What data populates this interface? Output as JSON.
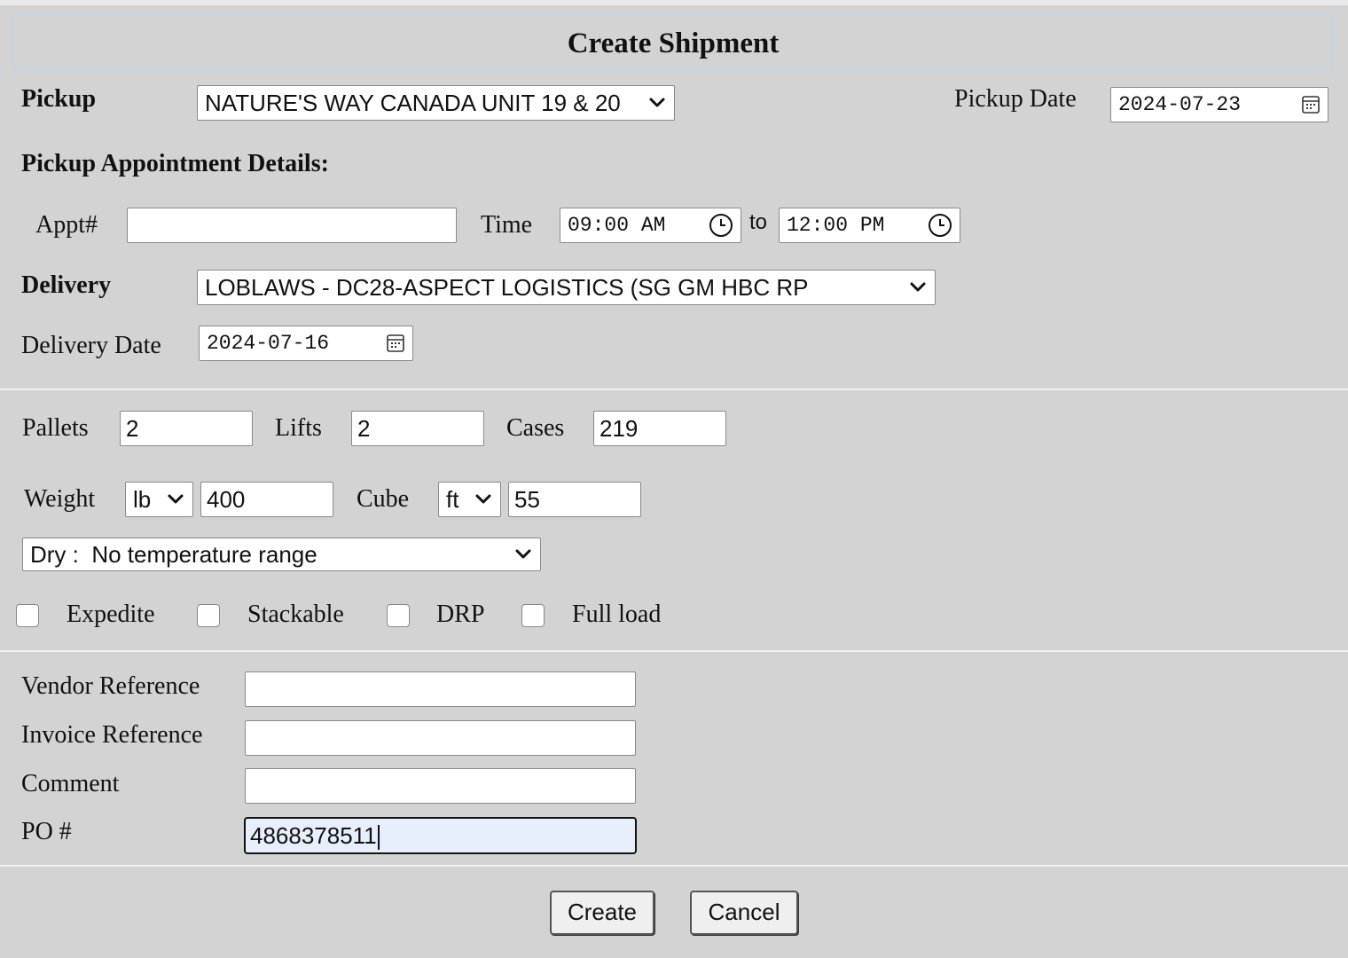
{
  "title": "Create Shipment",
  "pickup": {
    "label": "Pickup",
    "value": "NATURE'S WAY CANADA UNIT 19 & 20",
    "date_label": "Pickup Date",
    "date_value": "2024-07-23"
  },
  "appointment": {
    "heading": "Pickup Appointment Details:",
    "appt_label": "Appt#",
    "appt_value": "",
    "time_label": "Time",
    "time_from": "09:00 AM",
    "to_label": "to",
    "time_to": "12:00 PM"
  },
  "delivery": {
    "label": "Delivery",
    "value": "LOBLAWS - DC28-ASPECT LOGISTICS (SG GM HBC RP",
    "date_label": "Delivery Date",
    "date_value": "2024-07-16"
  },
  "quantities": {
    "pallets_label": "Pallets",
    "pallets_value": "2",
    "lifts_label": "Lifts",
    "lifts_value": "2",
    "cases_label": "Cases",
    "cases_value": "219",
    "weight_label": "Weight",
    "weight_unit": "lb",
    "weight_value": "400",
    "cube_label": "Cube",
    "cube_unit": "ft",
    "cube_value": "55"
  },
  "temperature": {
    "value": "Dry :  No temperature range"
  },
  "flags": {
    "expedite": {
      "label": "Expedite",
      "checked": false
    },
    "stackable": {
      "label": "Stackable",
      "checked": false
    },
    "drp": {
      "label": "DRP",
      "checked": false
    },
    "full_load": {
      "label": "Full load",
      "checked": false
    }
  },
  "references": {
    "vendor_label": "Vendor Reference",
    "vendor_value": "",
    "invoice_label": "Invoice Reference",
    "invoice_value": "",
    "comment_label": "Comment",
    "comment_value": "",
    "po_label": "PO #",
    "po_value": "4868378511"
  },
  "buttons": {
    "create": "Create",
    "cancel": "Cancel"
  },
  "icons": {
    "select": "chevron-down-icon",
    "date": "calendar-icon",
    "time": "clock-icon"
  }
}
